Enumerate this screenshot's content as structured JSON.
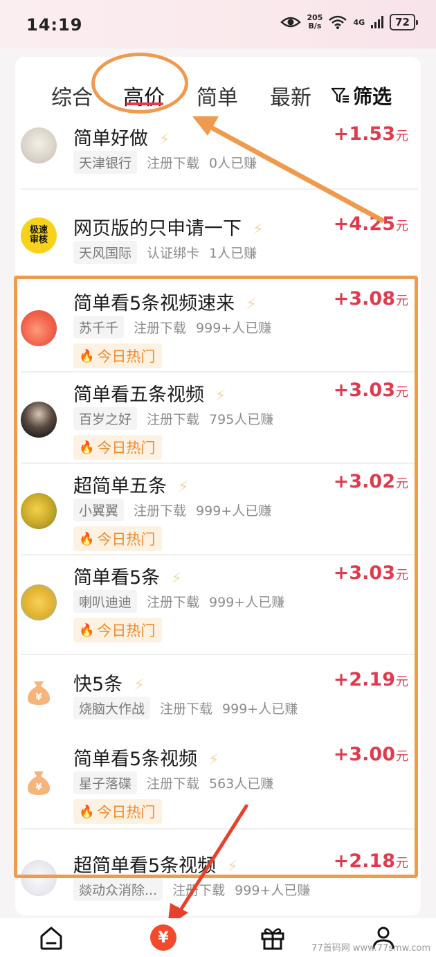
{
  "status_bar": {
    "time": "14:19",
    "speed_value": "205",
    "speed_unit": "B/s",
    "network": "4G",
    "battery": "72"
  },
  "tabs": [
    {
      "label": "综合"
    },
    {
      "label": "高价"
    },
    {
      "label": "简单"
    },
    {
      "label": "最新"
    }
  ],
  "active_tab": "高价",
  "filter_label": "筛选",
  "hot_label": "今日热门",
  "price_unit": "元",
  "tasks": [
    {
      "title": "简单好做",
      "price": "+1.53",
      "tags": [
        "天津银行",
        "注册下载",
        "0人已赚"
      ],
      "hot": false
    },
    {
      "title": "网页版的只申请一下",
      "price": "+4.25",
      "tags": [
        "天风国际",
        "认证绑卡",
        "1人已赚"
      ],
      "hot": false
    },
    {
      "title": "简单看5条视频速来",
      "price": "+3.08",
      "tags": [
        "苏千千",
        "注册下载",
        "999+人已赚"
      ],
      "hot": true
    },
    {
      "title": "简单看五条视频",
      "price": "+3.03",
      "tags": [
        "百岁之好",
        "注册下载",
        "795人已赚"
      ],
      "hot": true
    },
    {
      "title": "超简单五条",
      "price": "+3.02",
      "tags": [
        "小翼翼",
        "注册下载",
        "999+人已赚"
      ],
      "hot": true
    },
    {
      "title": "简单看5条",
      "price": "+3.03",
      "tags": [
        "喇叭迪迪",
        "注册下载",
        "999+人已赚"
      ],
      "hot": true
    },
    {
      "title": "快5条",
      "price": "+2.19",
      "tags": [
        "烧脑大作战",
        "注册下载",
        "999+人已赚"
      ],
      "hot": false
    },
    {
      "title": "简单看5条视频",
      "price": "+3.00",
      "tags": [
        "星子落碟",
        "注册下载",
        "563人已赚"
      ],
      "hot": true
    },
    {
      "title": "超简单看5条视频",
      "price": "+2.18",
      "tags": [
        "燚动众消除...",
        "注册下载",
        "999+人已赚"
      ],
      "hot": false
    }
  ],
  "avatar_logo_text": "极速审核",
  "watermark": "77首码网 www.77smw.com",
  "colors": {
    "accent": "#e23a4d",
    "annotation": "#f09a4e",
    "hot_text": "#f08a2e"
  }
}
